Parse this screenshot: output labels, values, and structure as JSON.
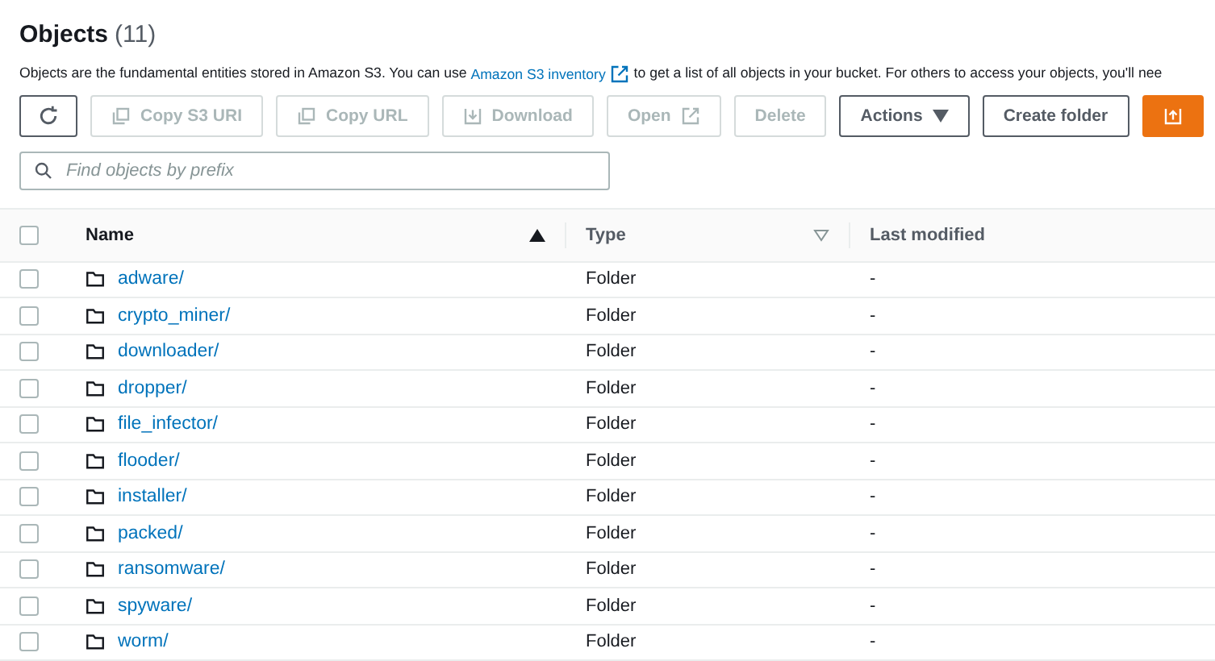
{
  "header": {
    "title": "Objects",
    "count": "(11)",
    "description_before": "Objects are the fundamental entities stored in Amazon S3. You can use ",
    "link": "Amazon S3 inventory",
    "description_after": " to get a list of all objects in your bucket. For others to access your objects, you'll nee"
  },
  "toolbar": [
    {
      "kind": "refresh",
      "disabled": false
    },
    {
      "kind": "copy",
      "label": "Copy S3 URI",
      "disabled": true
    },
    {
      "kind": "copy",
      "label": "Copy URL",
      "disabled": true
    },
    {
      "kind": "download",
      "label": "Download",
      "disabled": true
    },
    {
      "kind": "open",
      "label": "Open",
      "disabled": true
    },
    {
      "kind": "plain",
      "label": "Delete",
      "disabled": true
    },
    {
      "kind": "menu",
      "label": "Actions",
      "disabled": false
    },
    {
      "kind": "plain",
      "label": "Create folder",
      "disabled": false
    },
    {
      "kind": "primary",
      "disabled": false
    }
  ],
  "search": {
    "placeholder": "Find objects by prefix"
  },
  "table": {
    "select_all_checked": false,
    "columns": [
      {
        "label": "Name",
        "sortable": true,
        "sorted": true
      },
      {
        "label": "Type",
        "sortable": true,
        "sorted": false
      },
      {
        "label": "Last modified",
        "sortable": false,
        "sorted": false
      }
    ],
    "rows": [
      {
        "name": "adware/",
        "type": "Folder",
        "modified": "-",
        "checked": false
      },
      {
        "name": "crypto_miner/",
        "type": "Folder",
        "modified": "-",
        "checked": false
      },
      {
        "name": "downloader/",
        "type": "Folder",
        "modified": "-",
        "checked": false
      },
      {
        "name": "dropper/",
        "type": "Folder",
        "modified": "-",
        "checked": false
      },
      {
        "name": "file_infector/",
        "type": "Folder",
        "modified": "-",
        "checked": false
      },
      {
        "name": "flooder/",
        "type": "Folder",
        "modified": "-",
        "checked": false
      },
      {
        "name": "installer/",
        "type": "Folder",
        "modified": "-",
        "checked": false
      },
      {
        "name": "packed/",
        "type": "Folder",
        "modified": "-",
        "checked": false
      },
      {
        "name": "ransomware/",
        "type": "Folder",
        "modified": "-",
        "checked": false
      },
      {
        "name": "spyware/",
        "type": "Folder",
        "modified": "-",
        "checked": false
      },
      {
        "name": "worm/",
        "type": "Folder",
        "modified": "-",
        "checked": false
      }
    ]
  }
}
